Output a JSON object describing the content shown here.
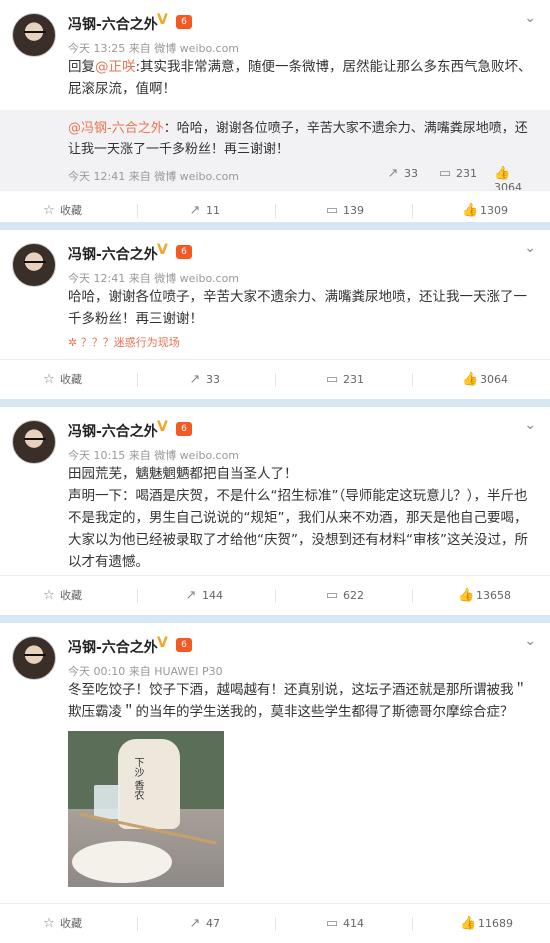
{
  "posts": [
    {
      "author": "冯钢-六合之外",
      "meta": "今天 13:25 来自 微博 weibo.com",
      "reply_prefix": "回复",
      "mention": "@正咲",
      "text": ":其实我非常满意，随便一条微博，居然能让那么多东西气急败坏、屁滚尿流，值啊！",
      "repost": {
        "author": "@冯钢-六合之外",
        "text": "哈哈，谢谢各位喷子，辛苦大家不遗余力、满嘴粪尿地喷，还让我一天涨了一千多粉丝！再三谢谢！",
        "time": "今天 12:41 来自 微博 weibo.com",
        "reposts": "33",
        "comments": "231",
        "likes": "3064"
      },
      "toolbar": {
        "fav": "收藏",
        "reposts": "11",
        "comments": "139",
        "likes": "1309"
      }
    },
    {
      "author": "冯钢-六合之外",
      "meta": "今天 12:41 来自 微博 weibo.com",
      "text": "哈哈，谢谢各位喷子，辛苦大家不遗余力、满嘴粪尿地喷，还让我一天涨了一千多粉丝！再三谢谢！",
      "warn": "？？？迷惑行为现场",
      "toolbar": {
        "fav": "收藏",
        "reposts": "33",
        "comments": "231",
        "likes": "3064"
      }
    },
    {
      "author": "冯钢-六合之外",
      "meta": "今天 10:15 来自 微博 weibo.com",
      "text1": "田园荒芜，魑魅魍魉都把自当圣人了！",
      "text2": "声明一下：喝酒是庆贺，不是什么“招生标准”（导师能定这玩意儿？），半斤也不是我定的，男生自己说说的“规矩”，我们从来不劝酒，那天是他自己要喝，大家以为他已经被录取了才给他“庆贺”，没想到还有材料“审核”这关没过，所以才有遗憾。",
      "toolbar": {
        "fav": "收藏",
        "reposts": "144",
        "comments": "622",
        "likes": "13658"
      }
    },
    {
      "author": "冯钢-六合之外",
      "meta": "今天 00:10 来自 HUAWEI P30",
      "text": "冬至吃饺子！饺子下酒，越喝越有！还真别说，这坛子酒还就是那所谓被我＂欺压霸凌＂的当年的学生送我的，莫非这些学生都得了斯德哥尔摩综合症？",
      "photo_label": "下沙 香农",
      "toolbar": {
        "fav": "收藏",
        "reposts": "47",
        "comments": "414",
        "likes": "11689"
      }
    }
  ]
}
